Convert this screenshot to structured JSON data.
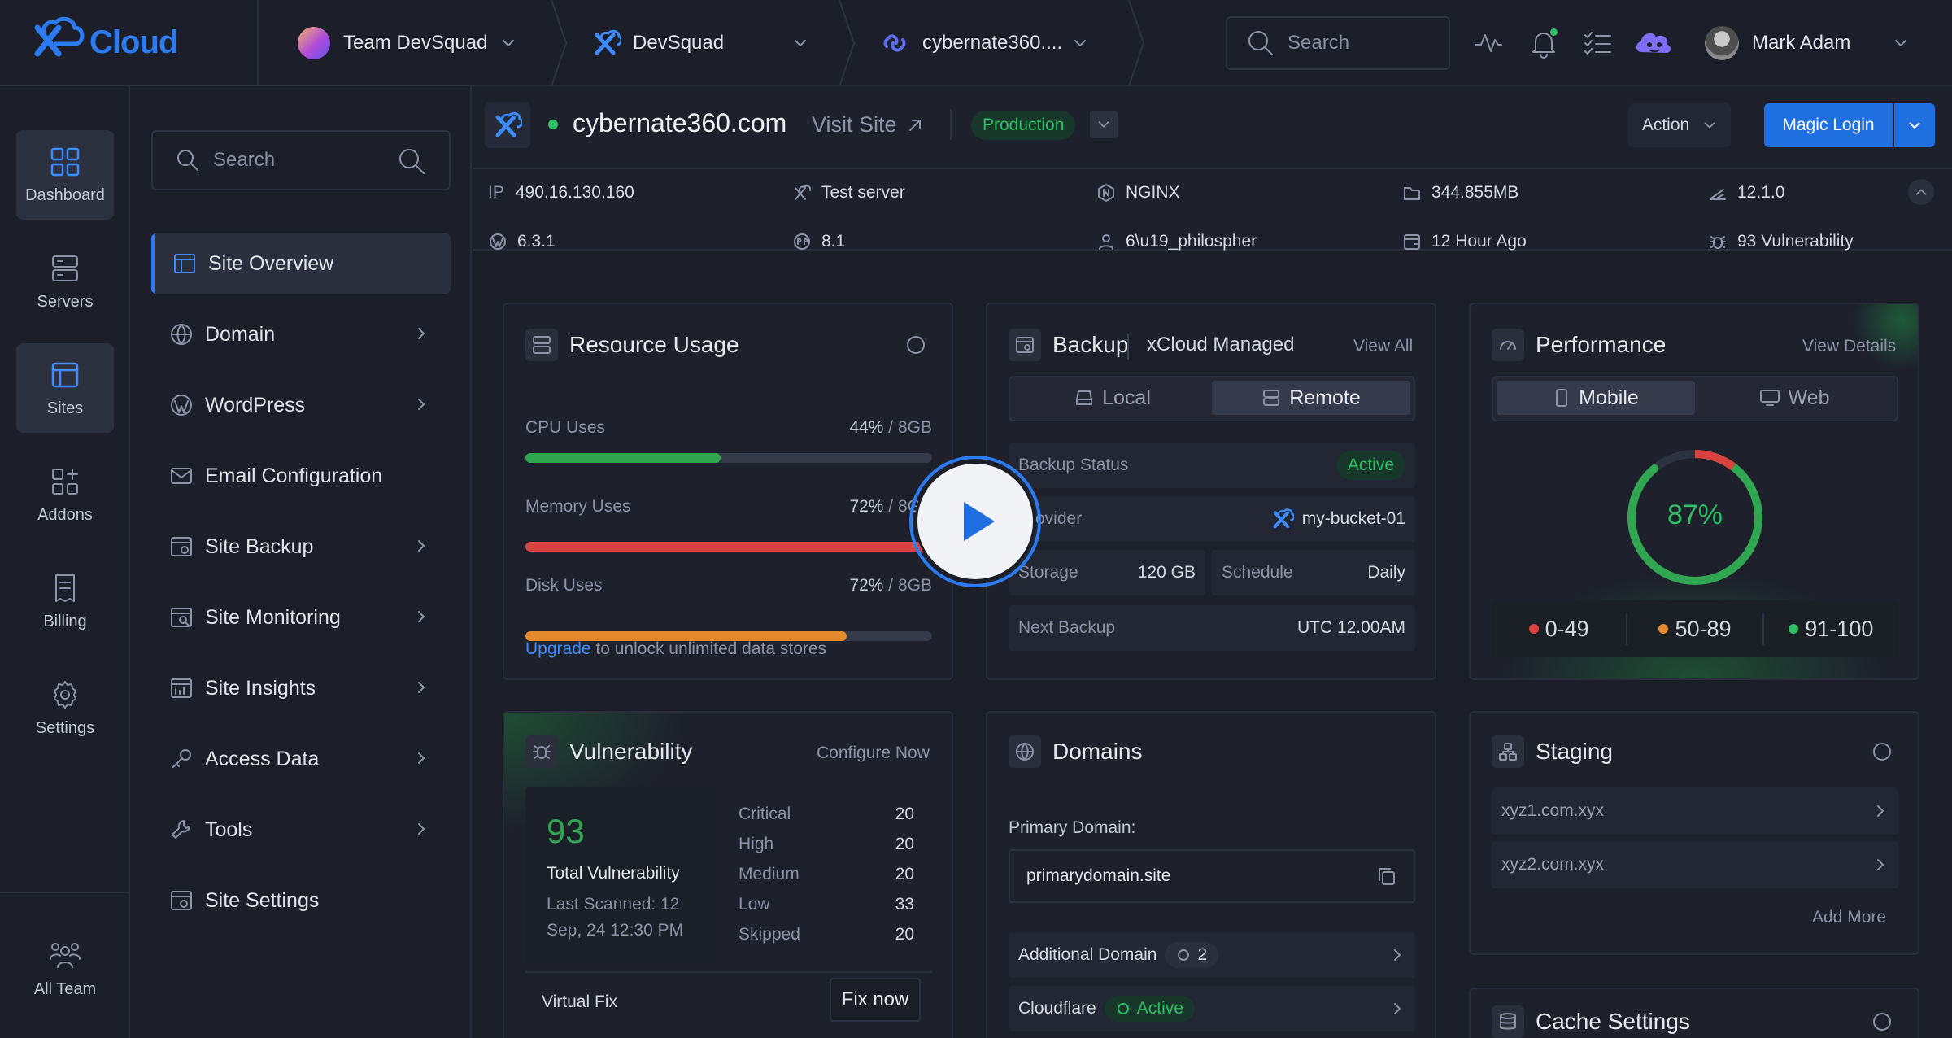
{
  "brand": {
    "name": "Cloud"
  },
  "topbar": {
    "team": "Team DevSquad",
    "server": "DevSquad",
    "site": "cybernate360....",
    "search_placeholder": "Search",
    "user": "Mark Adam"
  },
  "rail": {
    "items": [
      {
        "label": "Dashboard",
        "icon": "dashboard-icon"
      },
      {
        "label": "Servers",
        "icon": "server-icon"
      },
      {
        "label": "Sites",
        "icon": "sites-icon"
      },
      {
        "label": "Addons",
        "icon": "addons-icon"
      },
      {
        "label": "Billing",
        "icon": "billing-icon"
      },
      {
        "label": "Settings",
        "icon": "gear-icon"
      }
    ],
    "all_team": "All Team"
  },
  "nav": {
    "search_placeholder": "Search",
    "items": [
      {
        "label": "Site Overview"
      },
      {
        "label": "Domain"
      },
      {
        "label": "WordPress"
      },
      {
        "label": "Email Configuration"
      },
      {
        "label": "Site Backup"
      },
      {
        "label": "Site Monitoring"
      },
      {
        "label": "Site Insights"
      },
      {
        "label": "Access Data"
      },
      {
        "label": "Tools"
      },
      {
        "label": "Site Settings"
      }
    ]
  },
  "site": {
    "domain": "cybernate360.com",
    "visit": "Visit Site",
    "env": "Production",
    "action": "Action",
    "magic_login": "Magic Login",
    "info": {
      "ip_label": "IP",
      "ip": "490.16.130.160",
      "server": "Test server",
      "webserver": "NGINX",
      "disk": "344.855MB",
      "version": "12.1.0",
      "wp": "6.3.1",
      "php": "8.1",
      "user": "6\\u19_philospher",
      "updated": "12 Hour Ago",
      "vuln": "93 Vulnerability"
    }
  },
  "resource": {
    "title": "Resource Usage",
    "rows": [
      {
        "label": "CPU Uses",
        "pct": "44%",
        "cap": " / 8GB",
        "fill": 0.48,
        "color": "#2fa64f"
      },
      {
        "label": "Memory Uses",
        "pct": "72%",
        "cap": " / 8GB",
        "fill": 1.0,
        "color": "#d9423e"
      },
      {
        "label": "Disk Uses",
        "pct": "72%",
        "cap": " / 8GB",
        "fill": 0.79,
        "color": "#e68a2e"
      }
    ],
    "upgrade": "Upgrade",
    "upgrade_rest": " to unlock unlimited data stores"
  },
  "backup": {
    "title": "Backup",
    "subtitle": "xCloud Managed",
    "view_all": "View All",
    "tab_local": "Local",
    "tab_remote": "Remote",
    "status_label": "Backup Status",
    "status": "Active",
    "provider_label": "Provider",
    "provider": "my-bucket-01",
    "storage_label": "Storage",
    "storage": "120 GB",
    "schedule_label": "Schedule",
    "schedule": "Daily",
    "next_label": "Next Backup",
    "next": "UTC 12.00AM"
  },
  "performance": {
    "title": "Performance",
    "view": "View Details",
    "tab_mobile": "Mobile",
    "tab_web": "Web",
    "score": "87%",
    "score_value": 0.87,
    "legend": [
      {
        "label": "0-49",
        "color": "#d9423e"
      },
      {
        "label": "50-89",
        "color": "#e68a2e"
      },
      {
        "label": "91-100",
        "color": "#2fbf64"
      }
    ]
  },
  "vulnerability": {
    "title": "Vulnerability",
    "configure": "Configure Now",
    "count": "93",
    "total_label": "Total Vulnerability",
    "scanned": "Last Scanned: 12 Sep, 24 12:30 PM",
    "rows": [
      {
        "label": "Critical",
        "value": "20"
      },
      {
        "label": "High",
        "value": "20"
      },
      {
        "label": "Medium",
        "value": "20"
      },
      {
        "label": "Low",
        "value": "33"
      },
      {
        "label": "Skipped",
        "value": "20"
      }
    ],
    "virtual_fix": "Virtual Fix",
    "fix_now": "Fix now"
  },
  "domains": {
    "title": "Domains",
    "primary_label": "Primary Domain:",
    "primary": "primarydomain.site",
    "additional_label": "Additional Domain",
    "additional_count": "2",
    "cloudflare_label": "Cloudflare",
    "cloudflare_status": "Active"
  },
  "staging": {
    "title": "Staging",
    "items": [
      "xyz1.com.xyx",
      "xyz2.com.xyx"
    ],
    "add_more": "Add More"
  },
  "cache": {
    "title": "Cache Settings"
  }
}
